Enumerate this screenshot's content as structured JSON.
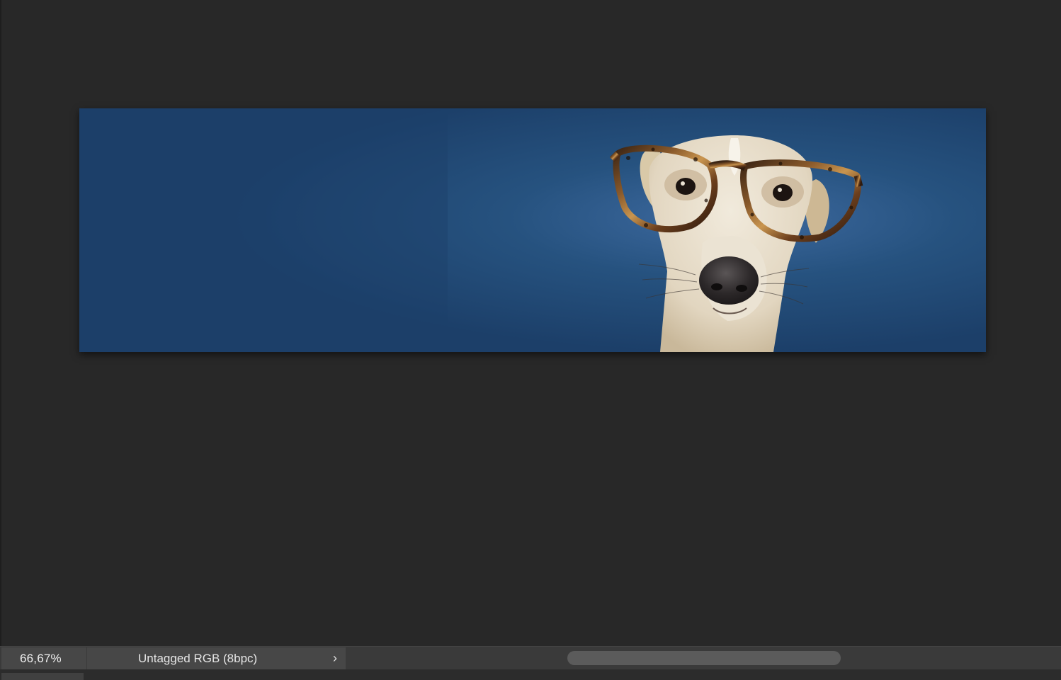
{
  "status_bar": {
    "zoom": "66,67%",
    "document_info": "Untagged RGB (8bpc)",
    "document_info_arrow": "›"
  },
  "canvas": {
    "image_description_icon": "dog-with-glasses-photo",
    "background_color": "#1f4470"
  },
  "icons": {
    "expand_arrow": "chevron-right-icon"
  }
}
